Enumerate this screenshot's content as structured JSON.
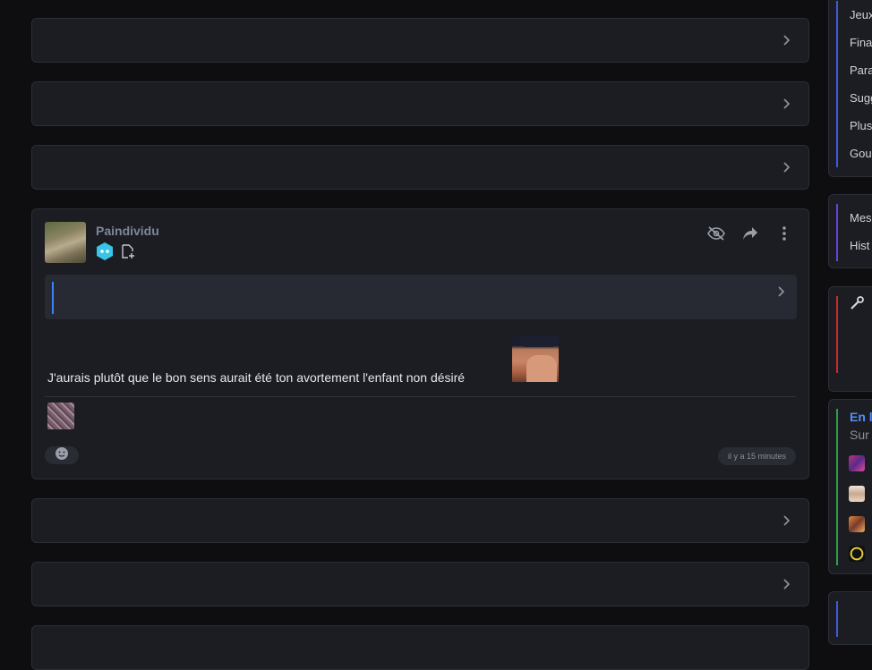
{
  "feed": {
    "post": {
      "author": "Paindividu",
      "message": "J'aurais plutôt que le bon sens aurait été ton avortement l'enfant non désiré",
      "timestamp": "il y a 15 minutes"
    }
  },
  "sidebar": {
    "menu_items": [
      "Jeux",
      "Fina",
      "Para",
      "Sugg",
      "Plus",
      "Gou"
    ],
    "secondary_items": [
      "Mes",
      "Hist"
    ],
    "online_title": "En li",
    "online_subtitle": "Sur"
  },
  "colors": {
    "background": "#0e0e10",
    "card": "#1c1d22",
    "accent_blue": "#3b82f6",
    "author_gray": "#7e8799",
    "side_line_blue": "#3b5bdb",
    "side_line_purple": "#6741d9",
    "side_line_red": "#c92a2a",
    "side_line_green": "#2f9e44"
  },
  "icons": {
    "collapse": "chevron-right-icon",
    "hide": "eye-off-icon",
    "share": "share-icon",
    "more": "more-vertical-icon",
    "badge": "hexagon-badge-icon",
    "doc": "file-plus-icon",
    "reaction": "emoji-icon",
    "tool": "wrench-icon"
  }
}
